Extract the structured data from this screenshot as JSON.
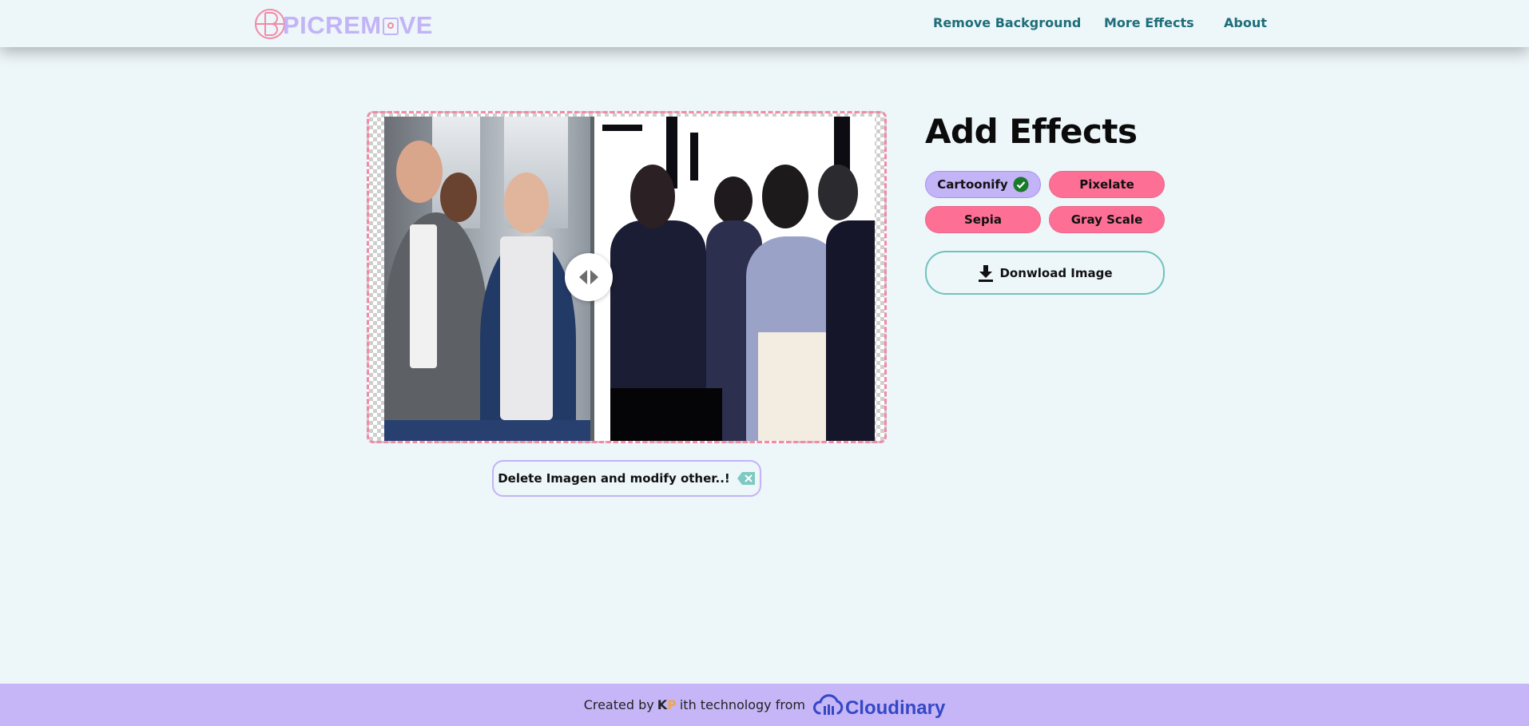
{
  "header": {
    "logo_text_pre": "PICREM",
    "logo_text_post": "VE",
    "nav": [
      "Remove Background",
      "More Effects",
      "About"
    ]
  },
  "editor": {
    "delete_label": "Delete Imagen and modify other..!"
  },
  "effects": {
    "title": "Add Effects",
    "buttons": [
      {
        "label": "Cartoonify",
        "active": true
      },
      {
        "label": "Pixelate",
        "active": false
      },
      {
        "label": "Sepia",
        "active": false
      },
      {
        "label": "Gray Scale",
        "active": false
      }
    ],
    "download_label": "Donwload Image"
  },
  "footer": {
    "created_by": "Created by",
    "author_mark": "KP",
    "tech_text": "ith technology from",
    "brand": "Cloudinary"
  },
  "colors": {
    "background": "#edf6f9",
    "pink": "#fd6f94",
    "lavender": "#c3b3f7",
    "teal": "#1d6e78",
    "cloudinary_blue": "#3448c5"
  }
}
